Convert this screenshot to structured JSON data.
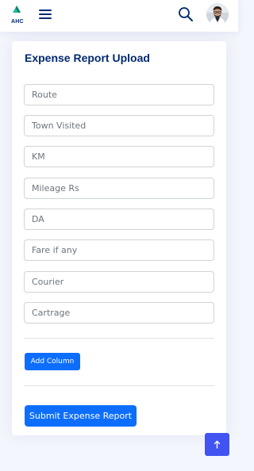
{
  "header": {
    "logo_text": "AHC",
    "colors": {
      "brand": "#012970",
      "accent": "#4154f1",
      "logo_teal": "#1abc9c"
    }
  },
  "form": {
    "title": "Expense Report Upload",
    "fields": [
      {
        "placeholder": "Route"
      },
      {
        "placeholder": "Town Visited"
      },
      {
        "placeholder": "KM"
      },
      {
        "placeholder": "Mileage Rs"
      },
      {
        "placeholder": "DA"
      },
      {
        "placeholder": "Fare if any"
      },
      {
        "placeholder": "Courier"
      },
      {
        "placeholder": "Cartrage"
      }
    ],
    "add_column_label": "Add Column",
    "submit_label": "Submit Expense Report",
    "colors": {
      "primary_button": "#0d6efd"
    }
  },
  "icons": {
    "menu": "hamburger-icon",
    "search": "search-icon",
    "avatar": "avatar",
    "scroll_top": "arrow-up-icon"
  }
}
